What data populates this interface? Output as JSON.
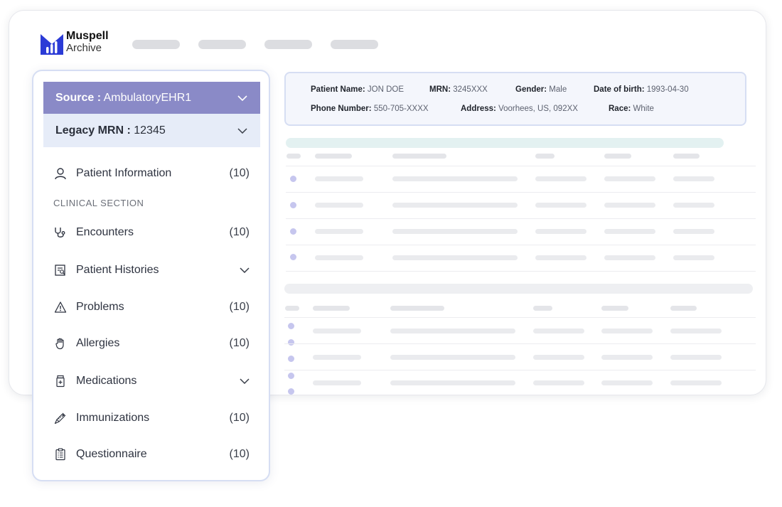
{
  "app": {
    "name": "Muspell",
    "subtitle": "Archive",
    "accent_color": "#2b3bd6"
  },
  "sidebar": {
    "source": {
      "label": "Source :",
      "value": "AmbulatoryEHR1"
    },
    "legacy_mrn": {
      "label": "Legacy MRN :",
      "value": "12345"
    },
    "section_title": "CLINICAL SECTION",
    "items": [
      {
        "label": "Patient Information",
        "count": "(10)",
        "icon": "person-icon"
      },
      {
        "label": "Encounters",
        "count": "(10)",
        "icon": "stethoscope-icon"
      },
      {
        "label": "Patient Histories",
        "icon": "history-document-icon",
        "expandable": true
      },
      {
        "label": "Problems",
        "count": "(10)",
        "icon": "warning-icon"
      },
      {
        "label": "Allergies",
        "count": "(10)",
        "icon": "hand-icon"
      },
      {
        "label": "Medications",
        "icon": "pill-bottle-icon",
        "expandable": true
      },
      {
        "label": "Immunizations",
        "count": "(10)",
        "icon": "syringe-icon"
      },
      {
        "label": "Questionnaire",
        "count": "(10)",
        "icon": "clipboard-icon"
      }
    ]
  },
  "patient": {
    "name_label": "Patient Name:",
    "name": "JON DOE",
    "mrn_label": "MRN:",
    "mrn": "3245XXX",
    "gender_label": "Gender:",
    "gender": "Male",
    "dob_label": "Date of birth:",
    "dob": "1993-04-30",
    "phone_label": "Phone Number:",
    "phone": "550-705-XXXX",
    "address_label": "Address:",
    "address": "Voorhees, US, 092XX",
    "race_label": "Race:",
    "race": "White"
  },
  "colors": {
    "source_bar": "#8a8ac7",
    "legacy_bar": "#e6ecf8",
    "card_bg": "#f4f6fc",
    "row_dot": "#c6c6ee"
  }
}
